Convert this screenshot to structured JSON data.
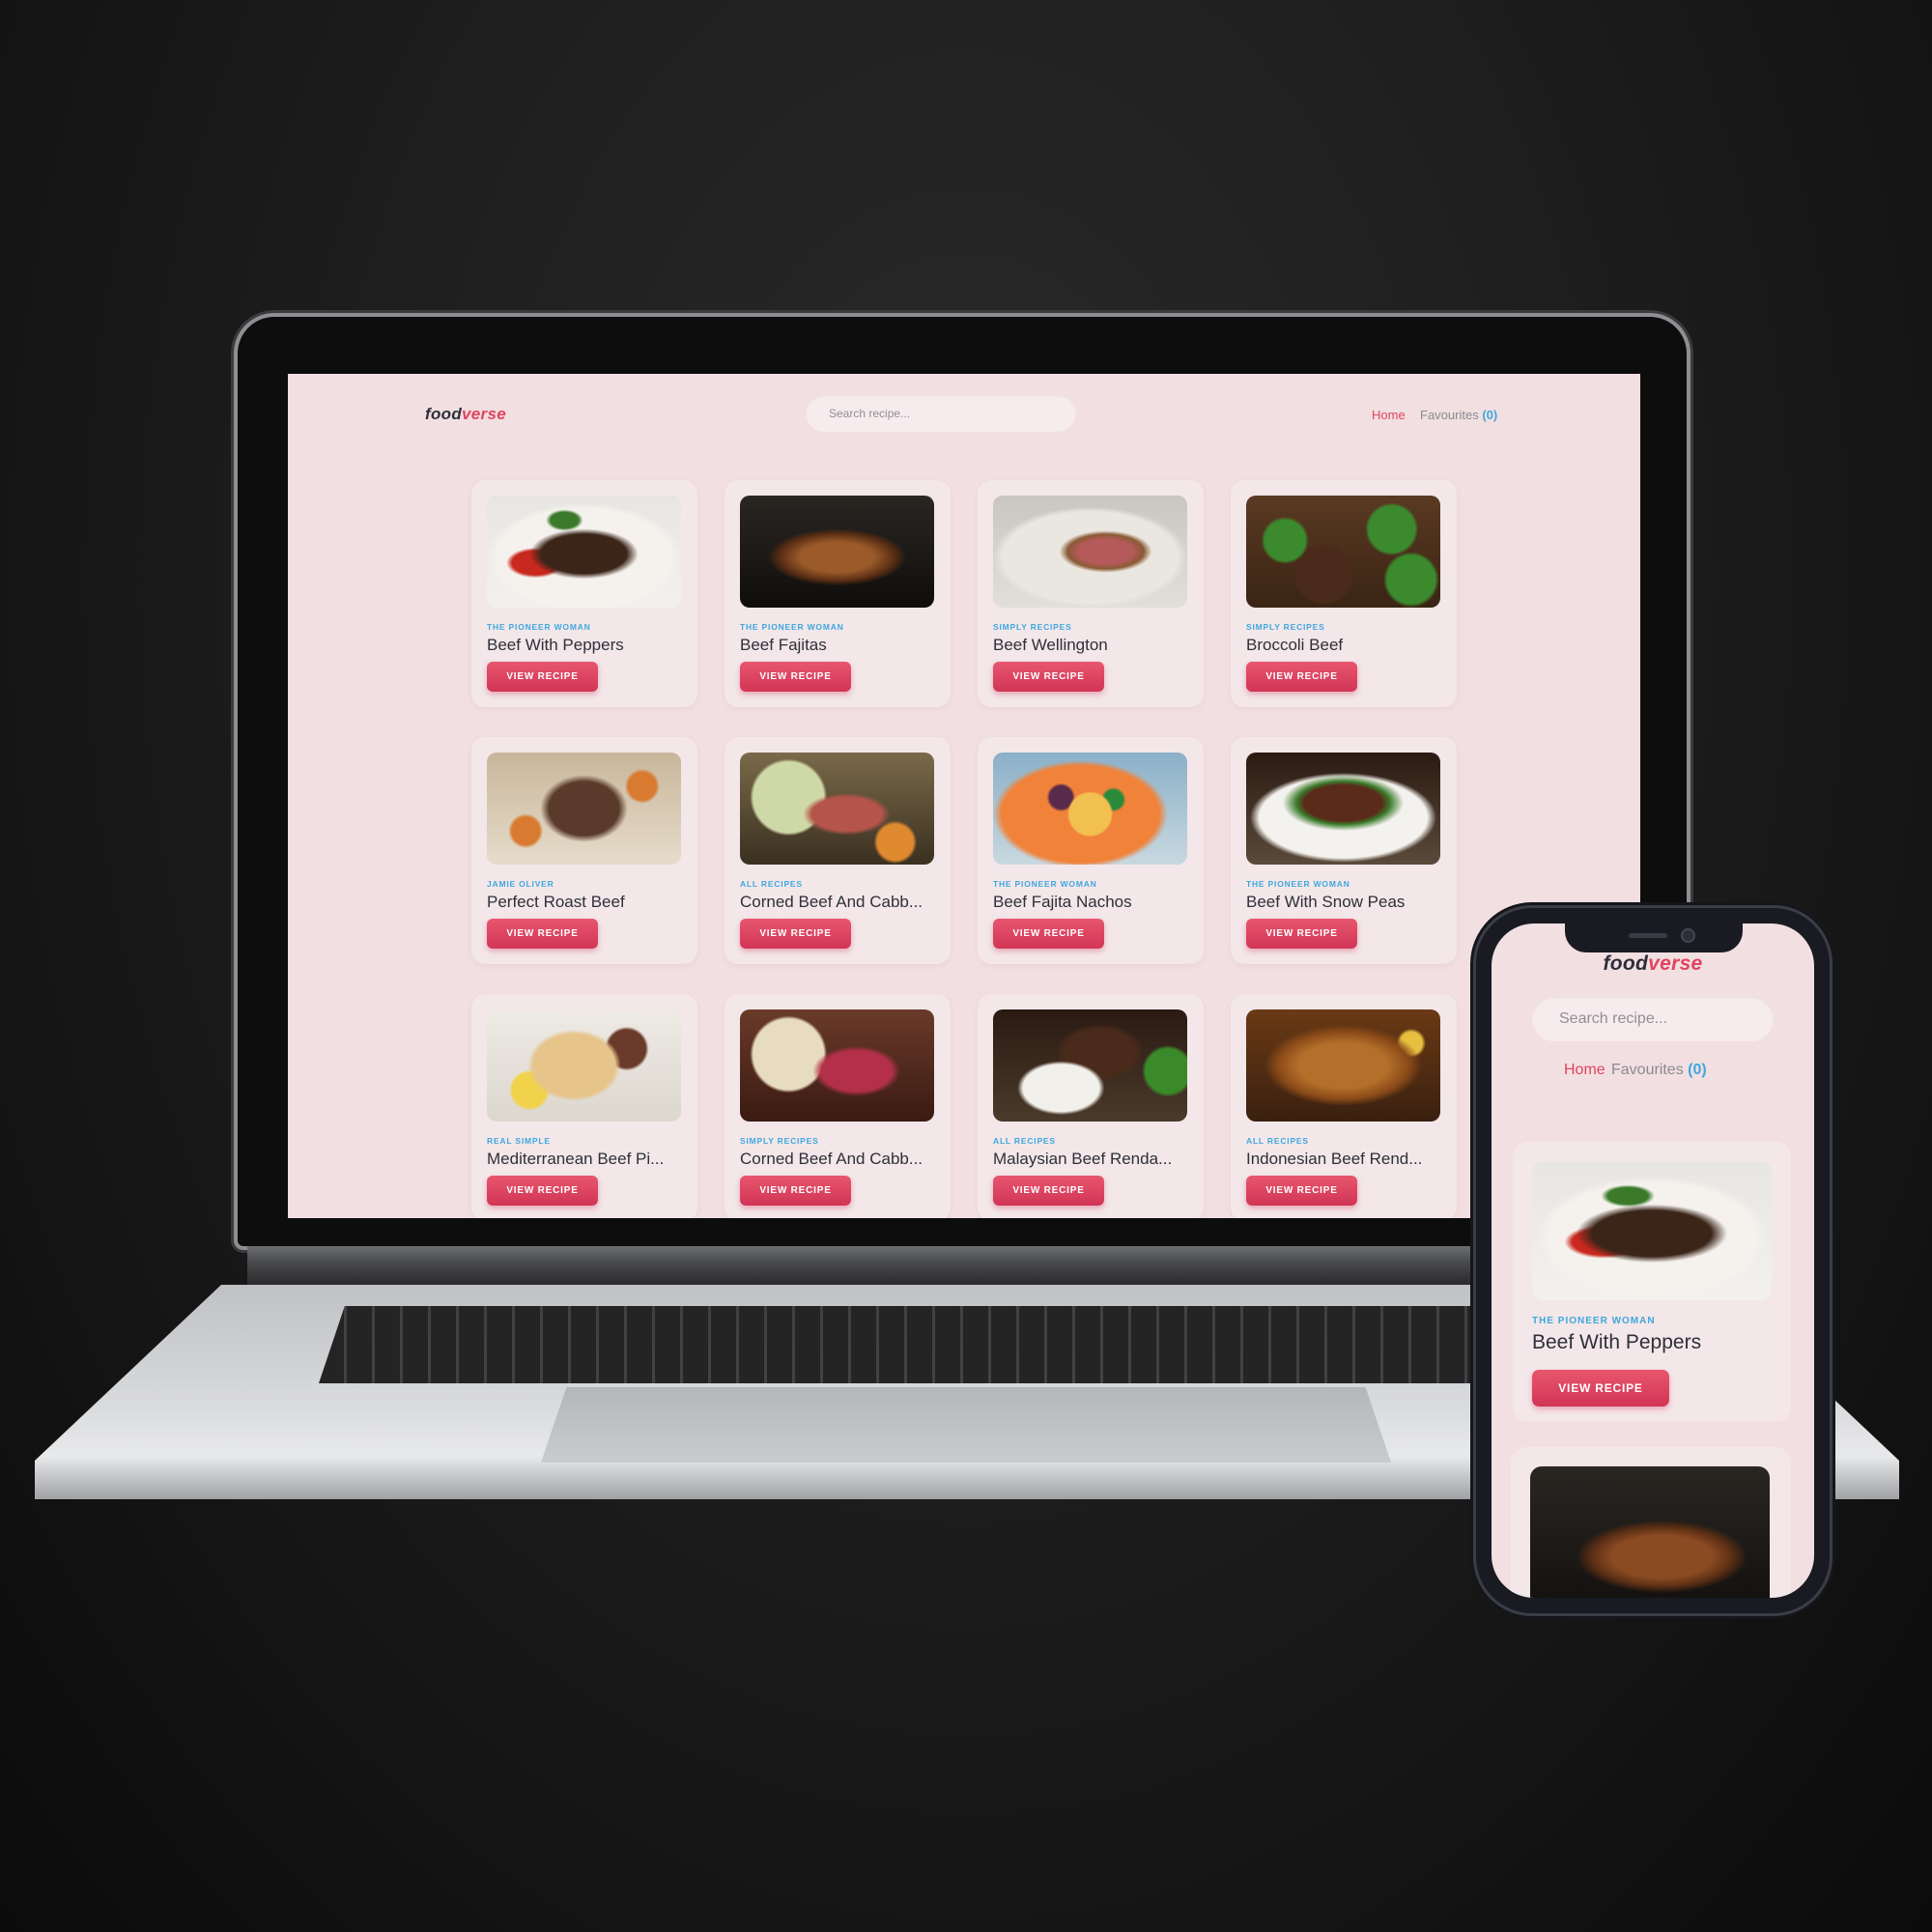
{
  "app": {
    "logo_part1": "food",
    "logo_part2": "verse",
    "search_placeholder": "Search recipe...",
    "nav_home": "Home",
    "nav_favourites": "Favourites",
    "nav_fav_count": "(0)",
    "view_label": "VIEW RECIPE"
  },
  "colors": {
    "accent": "#e0445f",
    "link_blue": "#3fa7de",
    "page_bg": "#f2dfe1",
    "card_bg": "#f3e7e9"
  },
  "recipes": [
    {
      "source": "The Pioneer Woman",
      "title": "Beef With Peppers",
      "image_icon": "beef-with-peppers-photo"
    },
    {
      "source": "The Pioneer Woman",
      "title": "Beef Fajitas",
      "image_icon": "beef-fajitas-photo"
    },
    {
      "source": "Simply Recipes",
      "title": "Beef Wellington",
      "image_icon": "beef-wellington-photo"
    },
    {
      "source": "Simply Recipes",
      "title": "Broccoli Beef",
      "image_icon": "broccoli-beef-photo"
    },
    {
      "source": "Jamie Oliver",
      "title": "Perfect Roast Beef",
      "image_icon": "roast-beef-photo"
    },
    {
      "source": "All Recipes",
      "title": "Corned Beef And Cabb...",
      "image_icon": "corned-beef-photo"
    },
    {
      "source": "The Pioneer Woman",
      "title": "Beef Fajita Nachos",
      "image_icon": "fajita-nachos-photo"
    },
    {
      "source": "The Pioneer Woman",
      "title": "Beef With Snow Peas",
      "image_icon": "snow-peas-photo"
    },
    {
      "source": "Real Simple",
      "title": "Mediterranean Beef Pi...",
      "image_icon": "beef-pita-photo"
    },
    {
      "source": "Simply Recipes",
      "title": "Corned Beef And Cabb...",
      "image_icon": "corned-beef-2-photo"
    },
    {
      "source": "All Recipes",
      "title": "Malaysian Beef Renda...",
      "image_icon": "malaysian-rendang-photo"
    },
    {
      "source": "All Recipes",
      "title": "Indonesian Beef Rend...",
      "image_icon": "indonesian-rendang-photo"
    }
  ],
  "phone": {
    "first_recipe": {
      "source": "The Pioneer Woman",
      "title": "Beef With Peppers"
    }
  }
}
